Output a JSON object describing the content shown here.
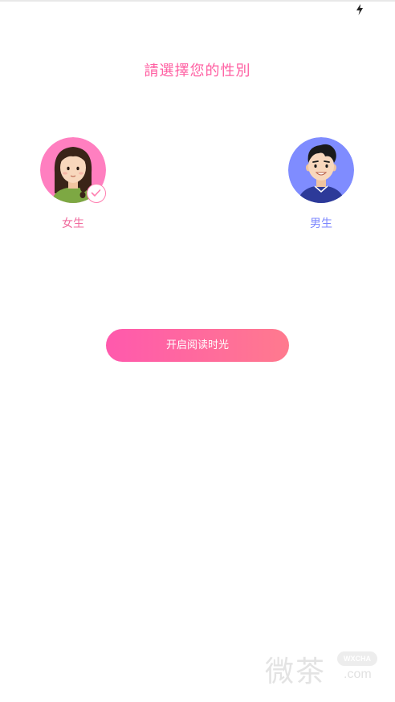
{
  "title": "請選擇您的性別",
  "options": [
    {
      "label": "女生",
      "selected": true
    },
    {
      "label": "男生",
      "selected": false
    }
  ],
  "start_button": "开启阅读时光",
  "watermark": {
    "chars": "微茶",
    "badge": "WXCHA",
    "domain": ".com"
  },
  "colors": {
    "accent_pink": "#ff5fa2",
    "female_bg": "#ff7fc0",
    "male_bg": "#7f8cff",
    "button_start": "#ff59ad",
    "button_end": "#ff7a8e"
  },
  "icons": {
    "status": "flash-icon",
    "selected": "check-icon"
  }
}
